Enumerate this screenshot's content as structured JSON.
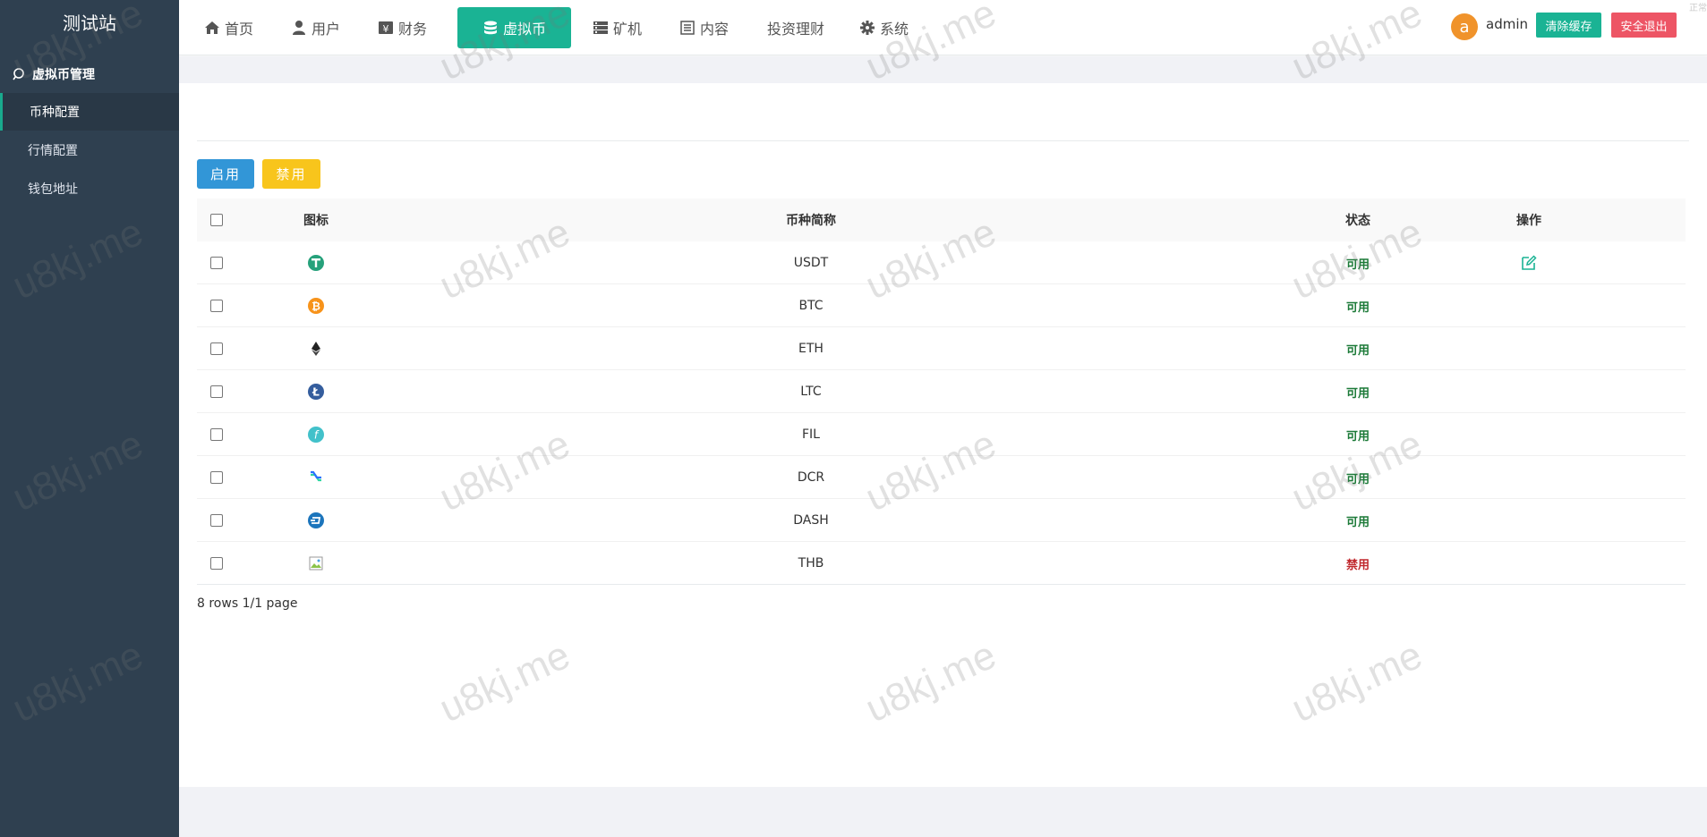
{
  "sidebar": {
    "title": "测试站",
    "group": "虚拟币管理",
    "items": [
      {
        "label": "币种配置",
        "active": true
      },
      {
        "label": "行情配置",
        "active": false
      },
      {
        "label": "钱包地址",
        "active": false
      }
    ]
  },
  "topnav": {
    "items": [
      {
        "label": "首页",
        "icon": "home-icon"
      },
      {
        "label": "用户",
        "icon": "user-icon"
      },
      {
        "label": "财务",
        "icon": "finance-icon"
      },
      {
        "label": "虚拟币",
        "icon": "database-icon",
        "active": true
      },
      {
        "label": "矿机",
        "icon": "server-icon"
      },
      {
        "label": "内容",
        "icon": "list-icon"
      },
      {
        "label": "投资理财",
        "icon": ""
      },
      {
        "label": "系统",
        "icon": "gear-icon"
      }
    ],
    "avatar_letter": "a",
    "username": "admin",
    "clear_cache": "清除缓存",
    "logout": "安全退出",
    "corner": "正常"
  },
  "toolbar": {
    "enable": "启用",
    "disable": "禁用"
  },
  "table": {
    "headers": {
      "icon": "图标",
      "name": "币种简称",
      "status": "状态",
      "op": "操作"
    },
    "rows": [
      {
        "icon": "usdt-icon",
        "name": "USDT",
        "status": "可用"
      },
      {
        "icon": "btc-icon",
        "name": "BTC",
        "status": "可用"
      },
      {
        "icon": "eth-icon",
        "name": "ETH",
        "status": "可用"
      },
      {
        "icon": "ltc-icon",
        "name": "LTC",
        "status": "可用"
      },
      {
        "icon": "fil-icon",
        "name": "FIL",
        "status": "可用"
      },
      {
        "icon": "dcr-icon",
        "name": "DCR",
        "status": "可用"
      },
      {
        "icon": "dash-icon",
        "name": "DASH",
        "status": "可用"
      },
      {
        "icon": "broken-image-icon",
        "name": "THB",
        "status": "禁用"
      }
    ]
  },
  "pager": "8 rows 1/1 page",
  "watermark": "u8kj.me",
  "colors": {
    "sidebar": "#2f4050",
    "accent": "#1ab394",
    "danger": "#ed5565",
    "primary": "#3296d7",
    "warning": "#f8c51c",
    "status_on": "#1c7a38",
    "status_off": "#c0282d"
  }
}
